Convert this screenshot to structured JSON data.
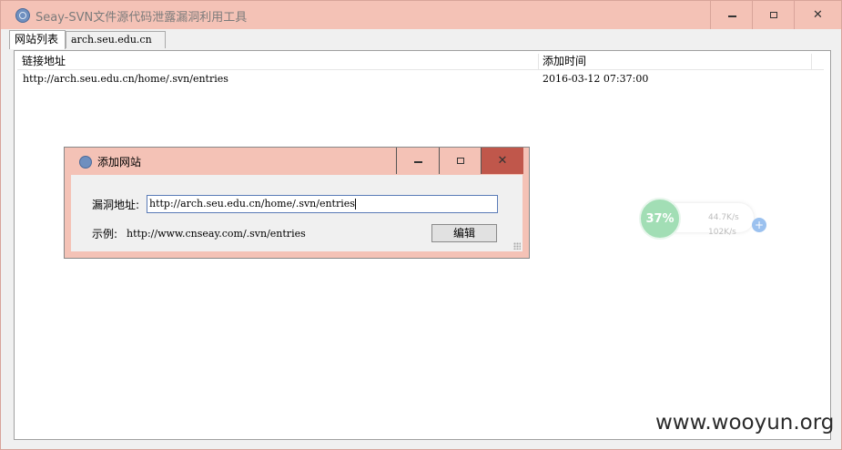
{
  "window": {
    "title": "Seay-SVN文件源代码泄露漏洞利用工具"
  },
  "tabs": [
    {
      "label": "网站列表"
    },
    {
      "label": "arch.seu.edu.cn"
    }
  ],
  "list": {
    "columns": [
      "链接地址",
      "添加时间"
    ],
    "rows": [
      {
        "url": "http://arch.seu.edu.cn/home/.svn/entries",
        "time": "2016-03-12 07:37:00"
      }
    ]
  },
  "dialog": {
    "title": "添加网站",
    "field_label": "漏洞地址:",
    "field_value": "http://arch.seu.edu.cn/home/.svn/entries",
    "example_label": "示例:",
    "example_value": "http://www.cnseay.com/.svn/entries",
    "button_label": "编辑"
  },
  "net_monitor": {
    "percent": "37%",
    "upload": "44.7K/s",
    "download": "102K/s"
  },
  "watermark": "www.wooyun.org"
}
